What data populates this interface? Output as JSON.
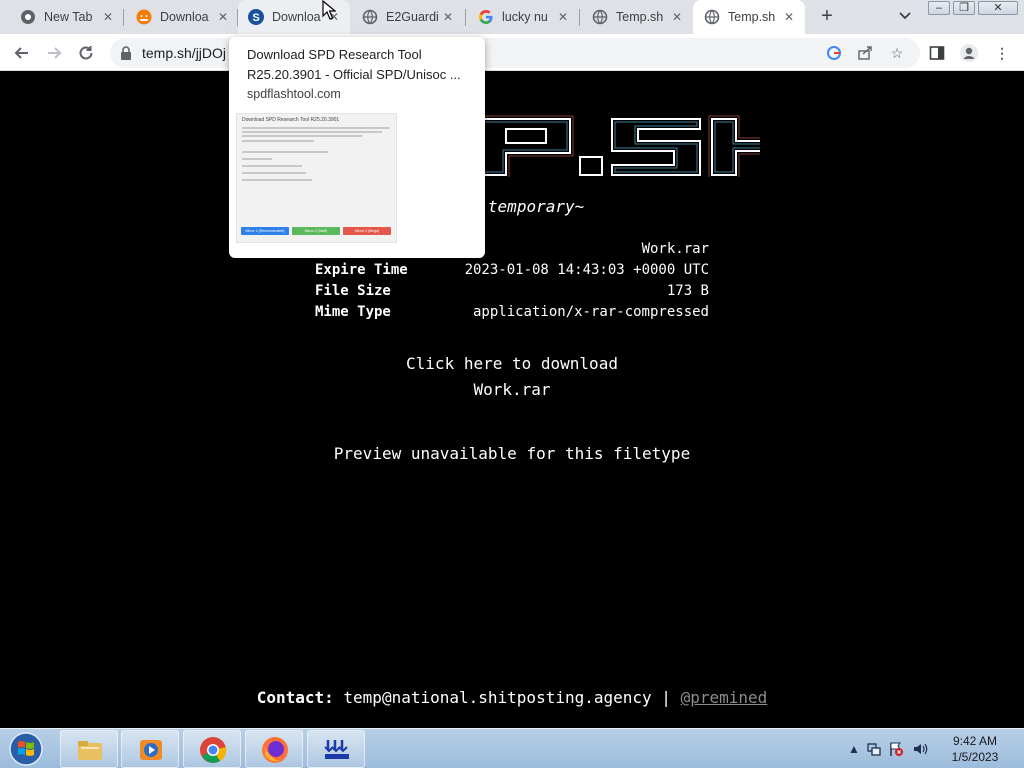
{
  "tabs": [
    {
      "title": "New Tab",
      "icon": "chrome-icon",
      "active": false
    },
    {
      "title": "Downloa",
      "icon": "android-icon",
      "active": false
    },
    {
      "title": "Downloa",
      "icon": "spd-s-icon",
      "active": false
    },
    {
      "title": "E2Guardi",
      "icon": "globe-icon",
      "active": false
    },
    {
      "title": "lucky nu",
      "icon": "google-icon",
      "active": false
    },
    {
      "title": "Temp.sh",
      "icon": "globe-icon",
      "active": false
    },
    {
      "title": "Temp.sh",
      "icon": "globe-icon",
      "active": true
    }
  ],
  "toolbar": {
    "url": "temp.sh/jjDOj"
  },
  "hover_card": {
    "title": "Download SPD Research Tool R25.20.3901 - Official SPD/Unisoc ...",
    "domain": "spdflashtool.com",
    "thumb_title": "Download SPD Research Tool R25.20.3901",
    "thumb_buttons": [
      "Mirror 1 (Recommended)",
      "Mirror 2 (Sarff)",
      "Mirror 3 (Mega)"
    ]
  },
  "page": {
    "tagline": "g is temporary~",
    "file_name": "Work.rar",
    "rows": [
      {
        "key": "Expire Time",
        "value": "2023-01-08 14:43:03 +0000 UTC"
      },
      {
        "key": "File Size",
        "value": "173 B"
      },
      {
        "key": "Mime Type",
        "value": "application/x-rar-compressed"
      }
    ],
    "download_line1": "Click here to download",
    "download_line2": "Work.rar",
    "preview_msg": "Preview unavailable for this filetype",
    "contact_label": "Contact:",
    "contact_email": "temp@national.shitposting.agency",
    "contact_sep": "|",
    "contact_handle": "@premined"
  },
  "taskbar": {
    "apps": [
      "explorer-folder-icon",
      "media-player-icon",
      "chrome-icon",
      "firefox-icon",
      "blue-arrows-app-icon"
    ],
    "time": "9:42 AM",
    "date": "1/5/2023"
  }
}
